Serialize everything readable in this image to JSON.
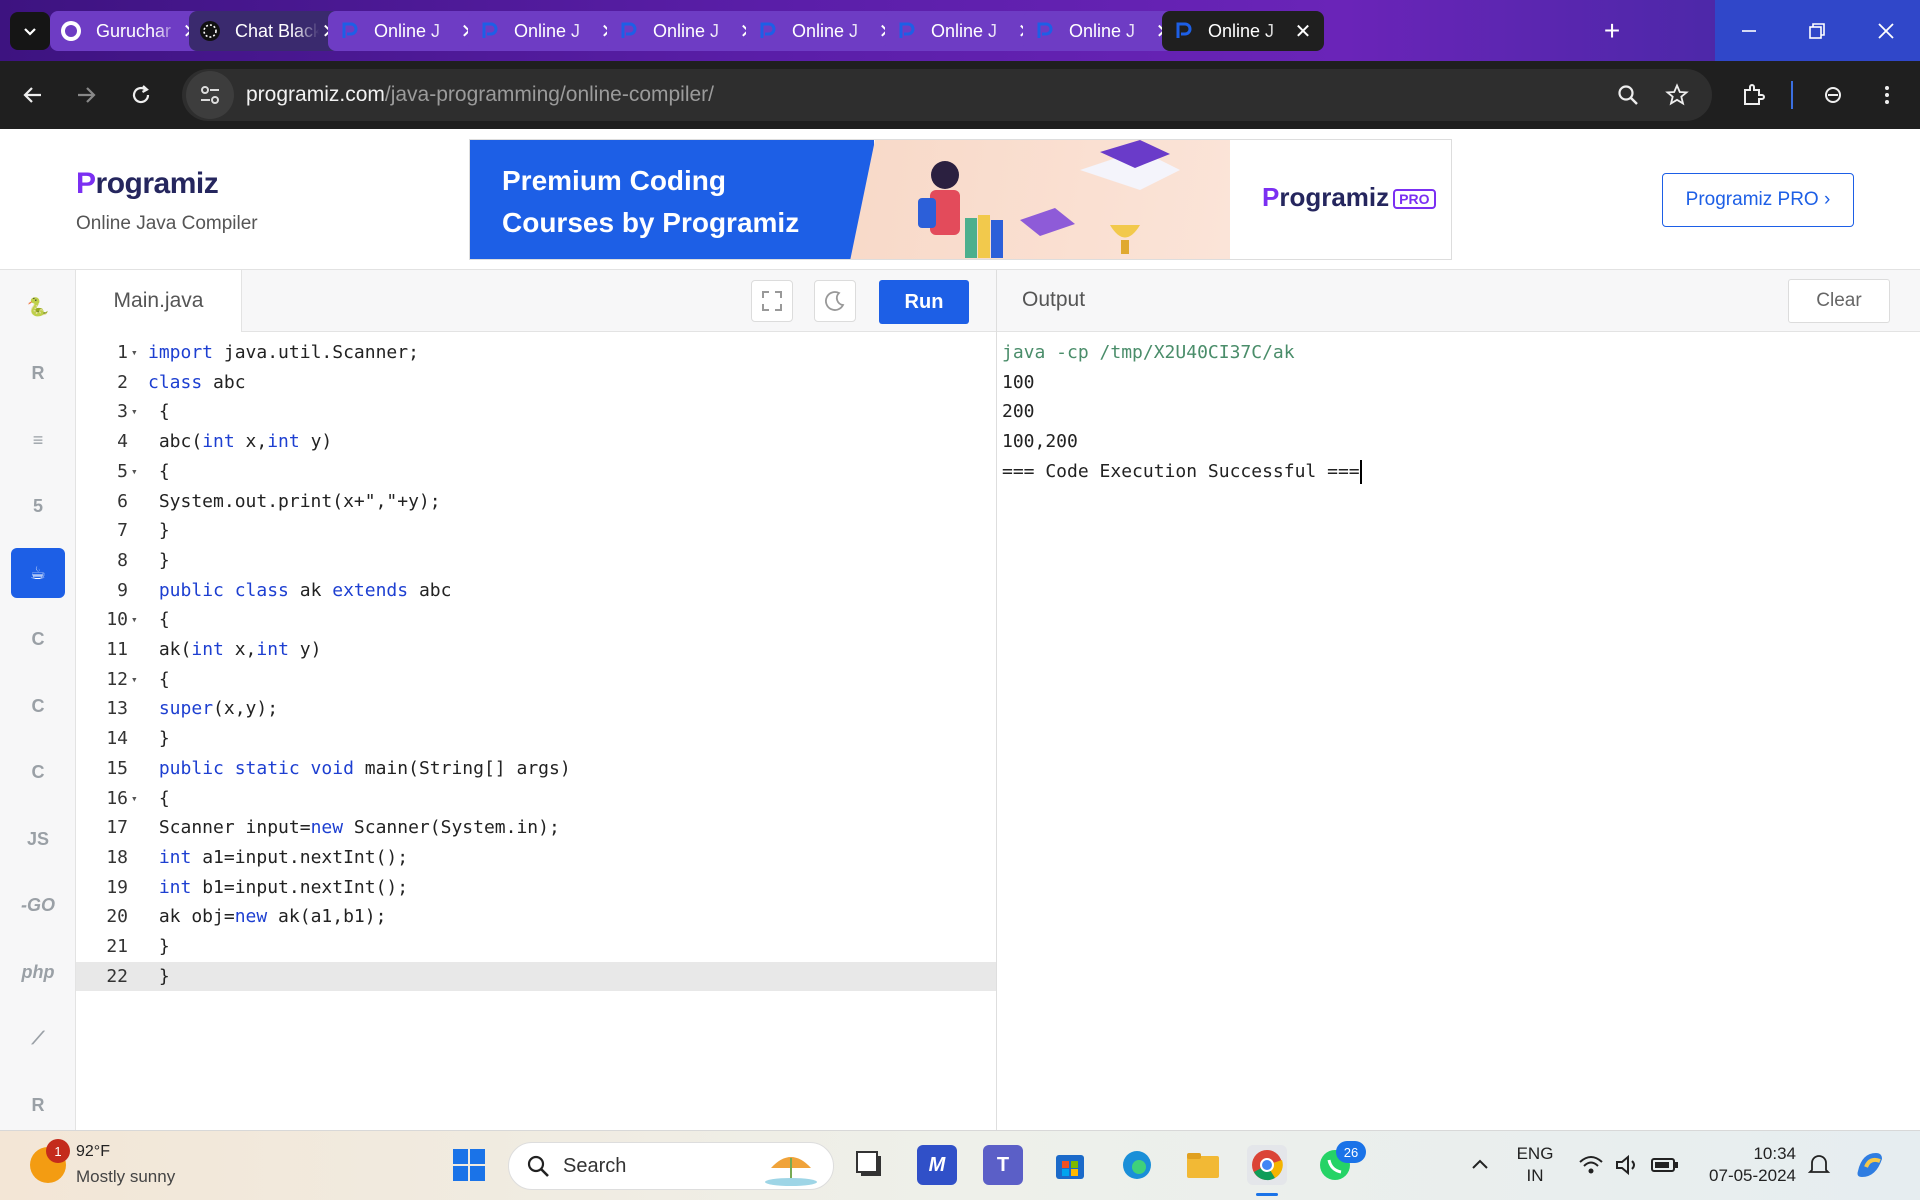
{
  "browser": {
    "tabs": [
      {
        "title": "Guruchar",
        "icon": "github-icon",
        "style": "light"
      },
      {
        "title": "Chat Black",
        "icon": "openai-icon",
        "style": "dark"
      },
      {
        "title": "Online J",
        "icon": "programiz-icon",
        "style": "light"
      },
      {
        "title": "Online J",
        "icon": "programiz-icon",
        "style": "light"
      },
      {
        "title": "Online J",
        "icon": "programiz-icon",
        "style": "light"
      },
      {
        "title": "Online J",
        "icon": "programiz-icon",
        "style": "light"
      },
      {
        "title": "Online J",
        "icon": "programiz-icon",
        "style": "light"
      },
      {
        "title": "Online J",
        "icon": "programiz-icon",
        "style": "light"
      },
      {
        "title": "Online J",
        "icon": "programiz-icon",
        "style": "active"
      }
    ],
    "url_host": "programiz.com",
    "url_path": "/java-programming/online-compiler/"
  },
  "header": {
    "logo": "Programiz",
    "subtitle": "Online Java Compiler",
    "banner_line1": "Premium Coding",
    "banner_line2": "Courses by Programiz",
    "banner_brand": "Programiz",
    "banner_badge": "PRO",
    "pro_button": "Programiz PRO ›"
  },
  "sidebar": {
    "languages": [
      {
        "name": "python",
        "glyph": "🐍"
      },
      {
        "name": "r",
        "glyph": "R"
      },
      {
        "name": "sql",
        "glyph": "≡"
      },
      {
        "name": "html",
        "glyph": "5"
      },
      {
        "name": "java",
        "glyph": "☕",
        "active": true
      },
      {
        "name": "c",
        "glyph": "C"
      },
      {
        "name": "cpp",
        "glyph": "C"
      },
      {
        "name": "csharp",
        "glyph": "C"
      },
      {
        "name": "js",
        "glyph": "JS"
      },
      {
        "name": "go",
        "glyph": "-GO"
      },
      {
        "name": "php",
        "glyph": "php"
      },
      {
        "name": "swift",
        "glyph": "⟋"
      },
      {
        "name": "rust",
        "glyph": "R"
      }
    ]
  },
  "editor": {
    "filename": "Main.java",
    "run_label": "Run",
    "lines": [
      {
        "n": "1",
        "fold": true,
        "html": "<span class='kw'>import</span> java.util.Scanner;"
      },
      {
        "n": "2",
        "fold": false,
        "html": "<span class='kw'>class</span> abc"
      },
      {
        "n": "3",
        "fold": true,
        "html": " {"
      },
      {
        "n": "4",
        "fold": false,
        "html": " abc(<span class='kw'>int</span> x,<span class='kw'>int</span> y)"
      },
      {
        "n": "5",
        "fold": true,
        "html": " {"
      },
      {
        "n": "6",
        "fold": false,
        "html": " System.out.print(x+\",\"+y);"
      },
      {
        "n": "7",
        "fold": false,
        "html": " }"
      },
      {
        "n": "8",
        "fold": false,
        "html": " }"
      },
      {
        "n": "9",
        "fold": false,
        "html": " <span class='kw'>public class</span> ak <span class='kw'>extends</span> abc"
      },
      {
        "n": "10",
        "fold": true,
        "html": " {"
      },
      {
        "n": "11",
        "fold": false,
        "html": " ak(<span class='kw'>int</span> x,<span class='kw'>int</span> y)"
      },
      {
        "n": "12",
        "fold": true,
        "html": " {"
      },
      {
        "n": "13",
        "fold": false,
        "html": " <span class='kw'>super</span>(x,y);"
      },
      {
        "n": "14",
        "fold": false,
        "html": " }"
      },
      {
        "n": "15",
        "fold": false,
        "html": " <span class='kw'>public static void</span> main(String[] args)"
      },
      {
        "n": "16",
        "fold": true,
        "html": " {"
      },
      {
        "n": "17",
        "fold": false,
        "html": " Scanner input=<span class='kw'>new</span> Scanner(System.in);"
      },
      {
        "n": "18",
        "fold": false,
        "html": " <span class='kw'>int</span> a1=input.nextInt();"
      },
      {
        "n": "19",
        "fold": false,
        "html": " <span class='kw'>int</span> b1=input.nextInt();"
      },
      {
        "n": "20",
        "fold": false,
        "html": " ak obj=<span class='kw'>new</span> ak(a1,b1);"
      },
      {
        "n": "21",
        "fold": false,
        "html": " }"
      },
      {
        "n": "22",
        "fold": false,
        "html": " }",
        "current": true
      }
    ]
  },
  "output": {
    "title": "Output",
    "clear_label": "Clear",
    "lines": [
      {
        "text": "java -cp /tmp/X2U40CI37C/ak",
        "cmd": true
      },
      {
        "text": "100"
      },
      {
        "text": "200"
      },
      {
        "text": "100,200"
      },
      {
        "text": "=== Code Execution Successful ===",
        "cursor": true
      }
    ]
  },
  "taskbar": {
    "weather_temp": "92°F",
    "weather_desc": "Mostly sunny",
    "weather_badge": "1",
    "search_label": "Search",
    "whatsapp_badge": "26",
    "lang_line1": "ENG",
    "lang_line2": "IN",
    "time": "10:34",
    "date": "07-05-2024"
  }
}
